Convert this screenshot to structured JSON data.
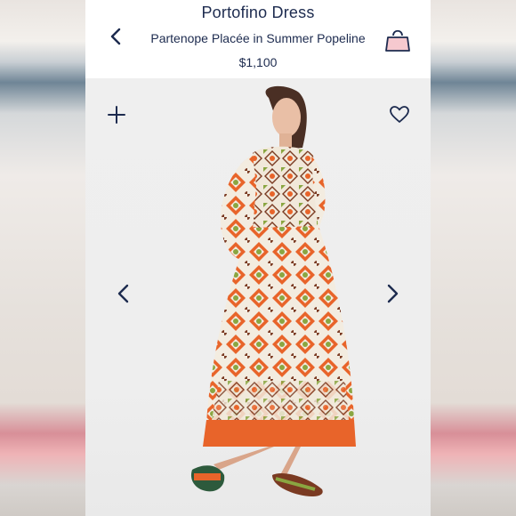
{
  "header": {
    "title": "Portofino Dress",
    "subtitle": "Partenope Placée in Summer Popeline",
    "price": "$1,100"
  },
  "icons": {
    "back": "chevron-left-icon",
    "bag": "shopping-bag-icon",
    "add": "plus-icon",
    "favorite": "heart-icon",
    "prev": "chevron-left-icon",
    "next": "chevron-right-icon"
  },
  "colors": {
    "text": "#1d2b4f",
    "bag_fill": "#f6c9cf",
    "dress_orange": "#e8642a",
    "dress_green": "#8aa641",
    "dress_brown": "#7a3a22",
    "dress_cream": "#f3ece0"
  }
}
